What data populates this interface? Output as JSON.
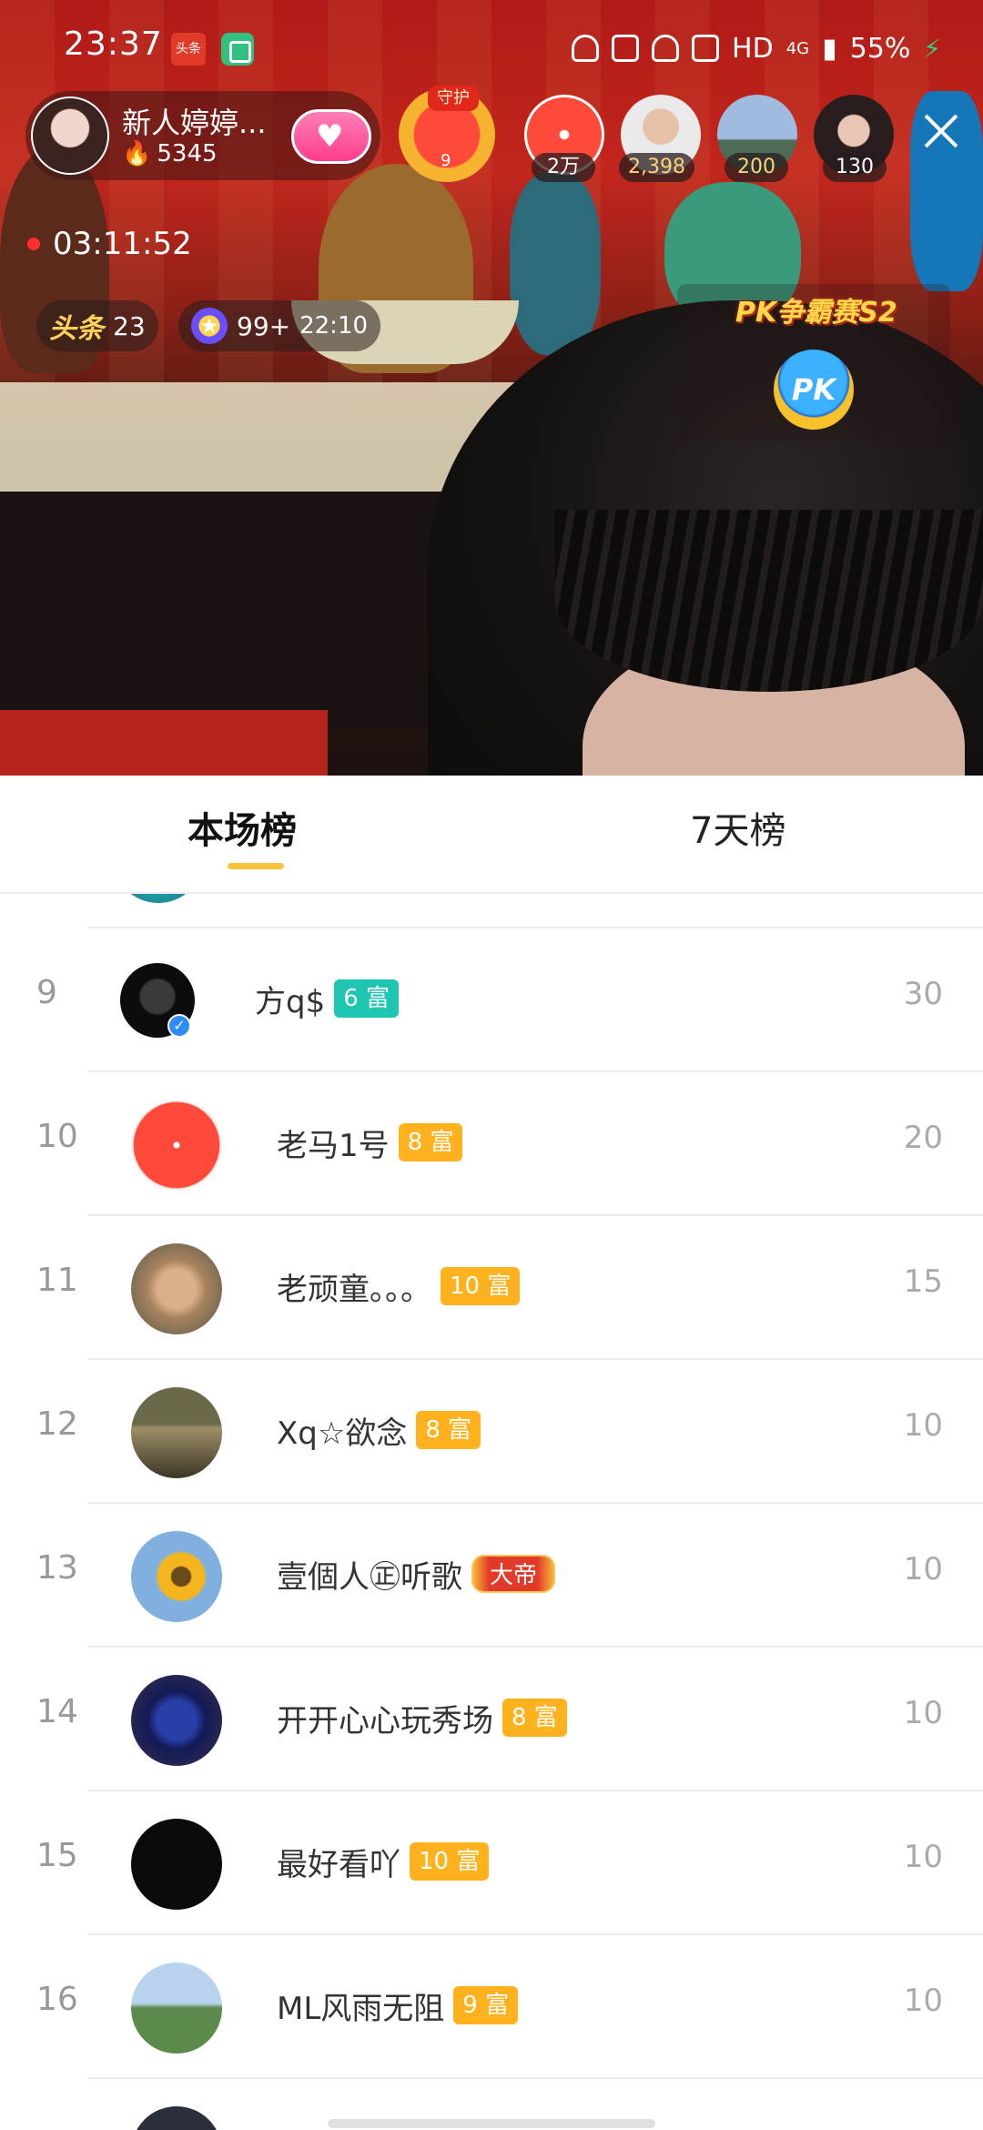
{
  "status_bar": {
    "time": "23:37",
    "app_icon_1_label": "头条",
    "network": "4G",
    "hd": "HD",
    "battery": "55%"
  },
  "host": {
    "name": "新人婷婷...",
    "fans": "5345"
  },
  "guard": {
    "tag": "守护",
    "level": "9"
  },
  "audience": [
    {
      "count": "2万"
    },
    {
      "count": "2,398"
    },
    {
      "count": "200"
    },
    {
      "count": "130"
    }
  ],
  "live": {
    "timer": "03:11:52",
    "toutiao_label": "头条",
    "toutiao_rank": "23",
    "star_label": "99+",
    "star_time": "22:10"
  },
  "pk": {
    "title": "PK争霸赛S2",
    "button": "PK"
  },
  "tabs": {
    "current": "本场榜",
    "week": "7天榜"
  },
  "ranking": [
    {
      "rank": "9",
      "name": "方q$",
      "badge": "6 富",
      "badge_style": "teal",
      "score": "30"
    },
    {
      "rank": "10",
      "name": "老马1号",
      "badge": "8 富",
      "badge_style": "orange",
      "score": "20"
    },
    {
      "rank": "11",
      "name": "老顽童。。。",
      "badge": "10 富",
      "badge_style": "orange",
      "score": "15"
    },
    {
      "rank": "12",
      "name": "Xq☆欲念",
      "badge": "8 富",
      "badge_style": "orange",
      "score": "10"
    },
    {
      "rank": "13",
      "name": "壹個人㊣听歌",
      "badge": "大帝",
      "badge_style": "emperor",
      "score": "10"
    },
    {
      "rank": "14",
      "name": "开开心心玩秀场",
      "badge": "8 富",
      "badge_style": "orange",
      "score": "10"
    },
    {
      "rank": "15",
      "name": "最好看吖",
      "badge": "10 富",
      "badge_style": "orange",
      "score": "10"
    },
    {
      "rank": "16",
      "name": "ML风雨无阻",
      "badge": "9 富",
      "badge_style": "orange",
      "score": "10"
    }
  ],
  "colors": {
    "accent_yellow": "#f9c23c",
    "badge_teal": "#1ec5b1",
    "badge_orange": "#ffb21e",
    "live_dot": "#ff2d2d"
  }
}
